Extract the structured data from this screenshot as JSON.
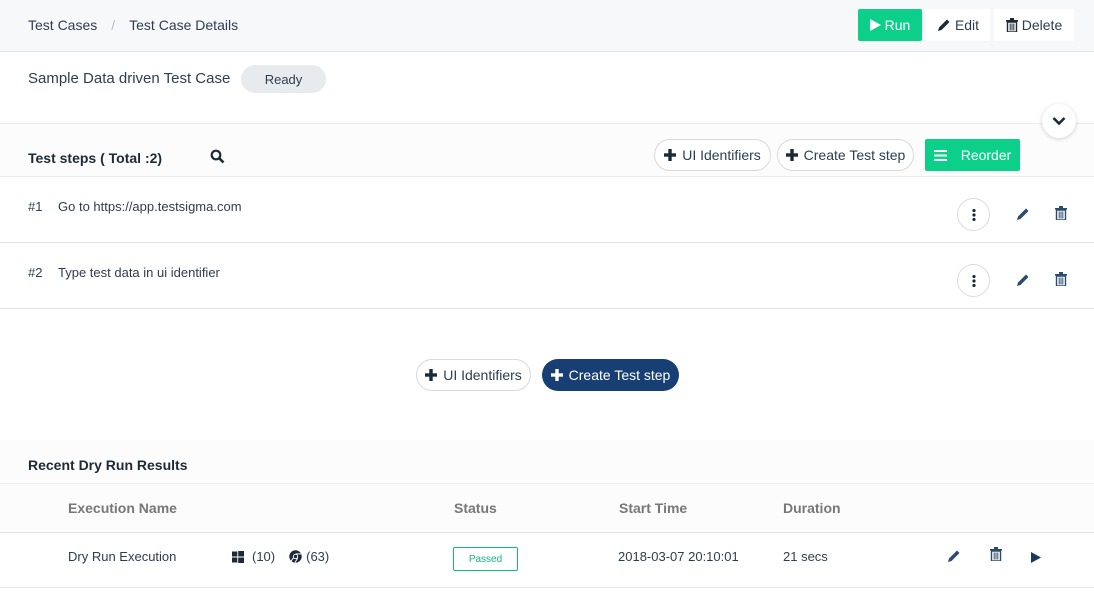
{
  "breadcrumb": {
    "items": [
      "Test Cases",
      "Test Case Details"
    ],
    "separator": "/"
  },
  "header_actions": {
    "run_label": "Run",
    "edit_label": "Edit",
    "delete_label": "Delete"
  },
  "test_case": {
    "title": "Sample Data driven Test Case",
    "status": "Ready"
  },
  "steps_section": {
    "title": "Test steps ( Total :2)",
    "ui_identifiers_label": "UI Identifiers",
    "create_step_label": "Create Test step",
    "reorder_label": "Reorder",
    "steps": [
      {
        "number": "#1",
        "text": "Go to https://app.testsigma.com"
      },
      {
        "number": "#2",
        "text": "Type test data in ui identifier"
      }
    ]
  },
  "bottom_actions": {
    "ui_identifiers_label": "UI Identifiers",
    "create_step_label": "Create Test step"
  },
  "results": {
    "title": "Recent Dry Run Results",
    "columns": [
      "Execution Name",
      "Status",
      "Start Time",
      "Duration"
    ],
    "rows": [
      {
        "name": "Dry Run Execution",
        "os_icon": "windows-icon",
        "os_version": "(10)",
        "browser_icon": "chrome-icon",
        "browser_version": "(63)",
        "status": "Passed",
        "start_time": "2018-03-07 20:10:01",
        "duration": "21 secs"
      }
    ]
  },
  "colors": {
    "primary_green": "#0ccf8a",
    "dark_blue": "#173f74",
    "passed": "#12b886",
    "text": "#2d3e50"
  }
}
